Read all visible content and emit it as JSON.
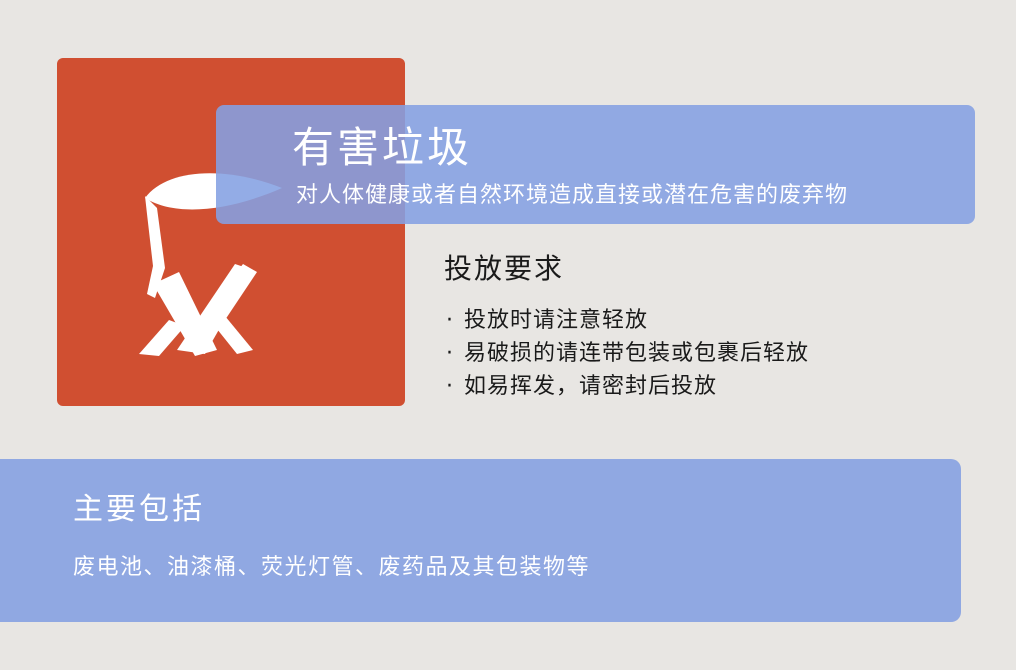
{
  "colors": {
    "background": "#e8e6e3",
    "icon_tile": "#d04f31",
    "banner": "#90a8e2",
    "text_light": "#ffffff",
    "text_dark": "#1a1a1a"
  },
  "icon": {
    "name": "hazardous-waste-icon"
  },
  "category": {
    "title": "有害垃圾",
    "description": "对人体健康或者自然环境造成直接或潜在危害的废弃物"
  },
  "requirements": {
    "heading": "投放要求",
    "bullet": "·",
    "items": [
      "投放时请注意轻放",
      "易破损的请连带包装或包裹后轻放",
      "如易挥发，请密封后投放"
    ]
  },
  "includes": {
    "heading": "主要包括",
    "text": "废电池、油漆桶、荧光灯管、废药品及其包装物等"
  }
}
